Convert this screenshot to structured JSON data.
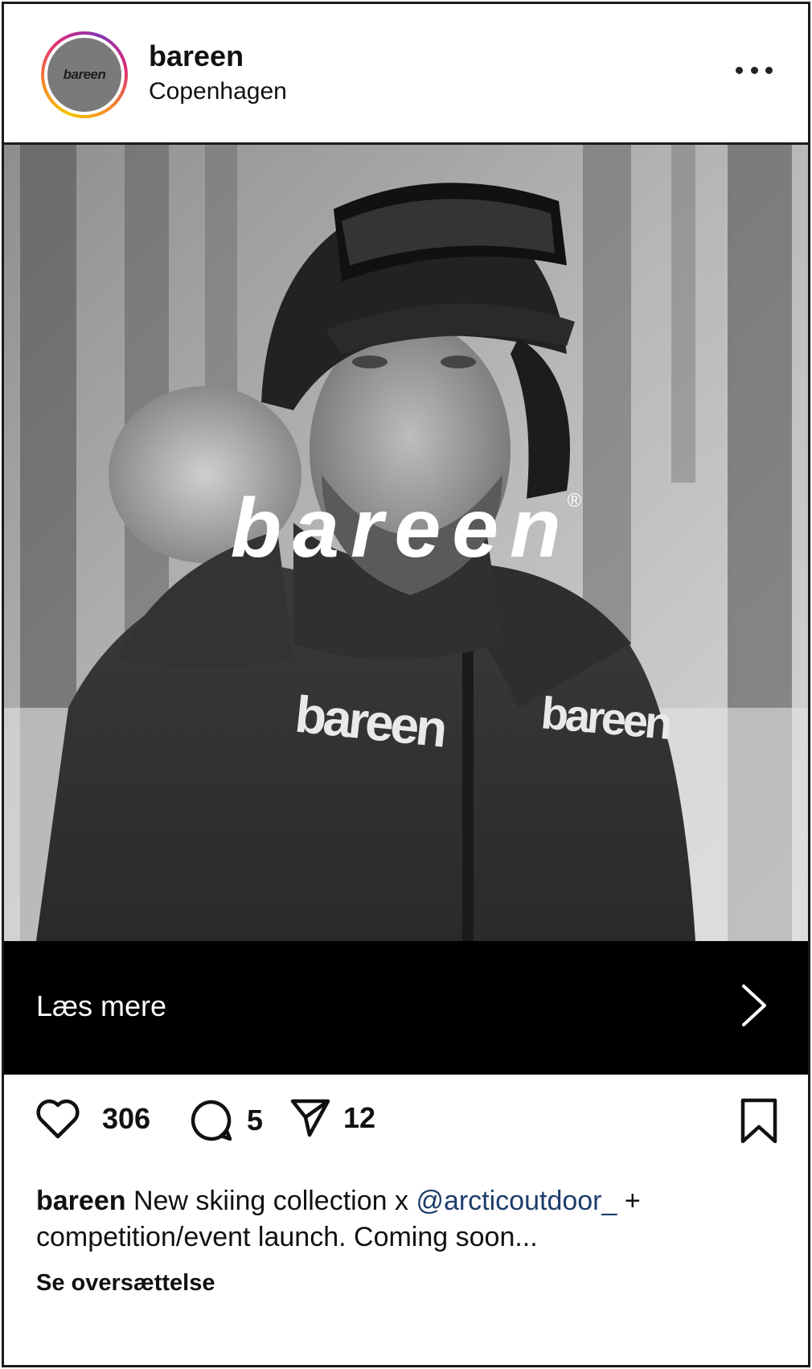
{
  "post": {
    "username": "bareen",
    "location": "Copenhagen",
    "avatar_text": "bareen",
    "image": {
      "overlay_brand": "bareen",
      "overlay_mark": "®",
      "chest_logo_left": "bareen",
      "chest_logo_right": "bareen"
    },
    "cta": {
      "label": "Læs mere"
    },
    "actions": {
      "likes": "306",
      "comments": "5",
      "shares": "12"
    },
    "caption": {
      "user": "bareen",
      "text_before": "New skiing collection x",
      "mention": "@arcticoutdoor_",
      "text_after": "+ competition/event launch. Coming soon..."
    },
    "translate_label": "Se oversættelse"
  },
  "icons": [
    "more-icon",
    "chevron-right-icon",
    "heart-icon",
    "comment-icon",
    "share-icon",
    "bookmark-icon"
  ],
  "colors": {
    "cta_background": "#000000",
    "mention": "#1d3e6b",
    "avatar_ring": "#dd2a7b"
  }
}
